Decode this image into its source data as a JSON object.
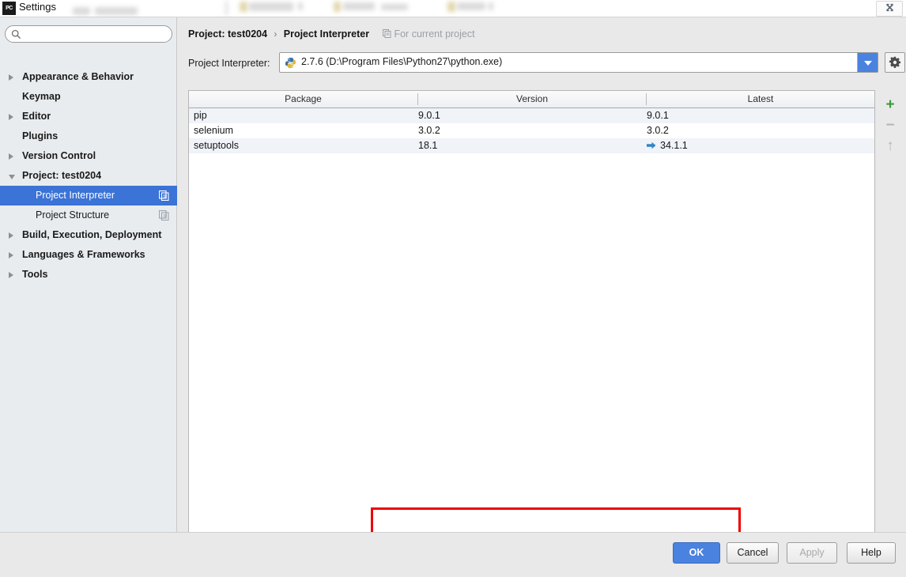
{
  "window": {
    "title": "Settings",
    "app_badge": "PC",
    "close_icon": "close-icon"
  },
  "sidebar": {
    "search": {
      "value": "",
      "placeholder": "",
      "icon": "search-icon"
    },
    "items": [
      {
        "label": "Appearance & Behavior",
        "depth": 0,
        "arrow": "collapsed",
        "selected": false,
        "dup_icon": false
      },
      {
        "label": "Keymap",
        "depth": 0,
        "arrow": "none",
        "selected": false,
        "dup_icon": false
      },
      {
        "label": "Editor",
        "depth": 0,
        "arrow": "collapsed",
        "selected": false,
        "dup_icon": false
      },
      {
        "label": "Plugins",
        "depth": 0,
        "arrow": "none",
        "selected": false,
        "dup_icon": false
      },
      {
        "label": "Version Control",
        "depth": 0,
        "arrow": "collapsed",
        "selected": false,
        "dup_icon": false
      },
      {
        "label": "Project: test0204",
        "depth": 0,
        "arrow": "expanded",
        "selected": false,
        "dup_icon": false
      },
      {
        "label": "Project Interpreter",
        "depth": 1,
        "arrow": "none",
        "selected": true,
        "dup_icon": true
      },
      {
        "label": "Project Structure",
        "depth": 1,
        "arrow": "none",
        "selected": false,
        "dup_icon": true
      },
      {
        "label": "Build, Execution, Deployment",
        "depth": 0,
        "arrow": "collapsed",
        "selected": false,
        "dup_icon": false
      },
      {
        "label": "Languages & Frameworks",
        "depth": 0,
        "arrow": "collapsed",
        "selected": false,
        "dup_icon": false
      },
      {
        "label": "Tools",
        "depth": 0,
        "arrow": "collapsed",
        "selected": false,
        "dup_icon": false
      }
    ]
  },
  "main": {
    "breadcrumb": {
      "parent": "Project: test0204",
      "separator": "›",
      "current": "Project Interpreter",
      "scope_note": "For current project",
      "scope_icon": "duplicate-icon"
    },
    "interpreter": {
      "label": "Project Interpreter:",
      "value": "2.7.6 (D:\\Program Files\\Python27\\python.exe)",
      "icon": "python-icon",
      "dropdown_icon": "chevron-down-icon",
      "settings_icon": "gear-icon"
    },
    "packages_table": {
      "columns": [
        "Package",
        "Version",
        "Latest"
      ],
      "rows": [
        {
          "package": "pip",
          "version": "9.0.1",
          "latest": "9.0.1",
          "upgradable": false
        },
        {
          "package": "selenium",
          "version": "3.0.2",
          "latest": "3.0.2",
          "upgradable": false
        },
        {
          "package": "setuptools",
          "version": "18.1",
          "latest": "34.1.1",
          "upgradable": true
        }
      ]
    },
    "tool_rail": [
      {
        "name": "add-package-button",
        "glyph": "+",
        "color": "#3c9a3c",
        "enabled": true
      },
      {
        "name": "remove-package-button",
        "glyph": "−",
        "color": "#b6b6b6",
        "enabled": false
      },
      {
        "name": "upgrade-package-button",
        "glyph": "↑",
        "color": "#b6b6b6",
        "enabled": false
      }
    ],
    "annotation": {
      "name": "red-highlight-box",
      "color": "#ee0000"
    }
  },
  "footer": {
    "buttons": [
      {
        "label": "OK",
        "style": "primary",
        "enabled": true
      },
      {
        "label": "Cancel",
        "style": "normal",
        "enabled": true
      },
      {
        "label": "Apply",
        "style": "disabled",
        "enabled": false
      },
      {
        "label": "Help",
        "style": "normal",
        "enabled": true
      }
    ]
  },
  "colors": {
    "accent": "#4a82e0",
    "selection": "#3b73d6",
    "row_stripe": "#f0f3f8",
    "annotation": "#ee0000",
    "sidebar_bg": "#e9ecef"
  }
}
